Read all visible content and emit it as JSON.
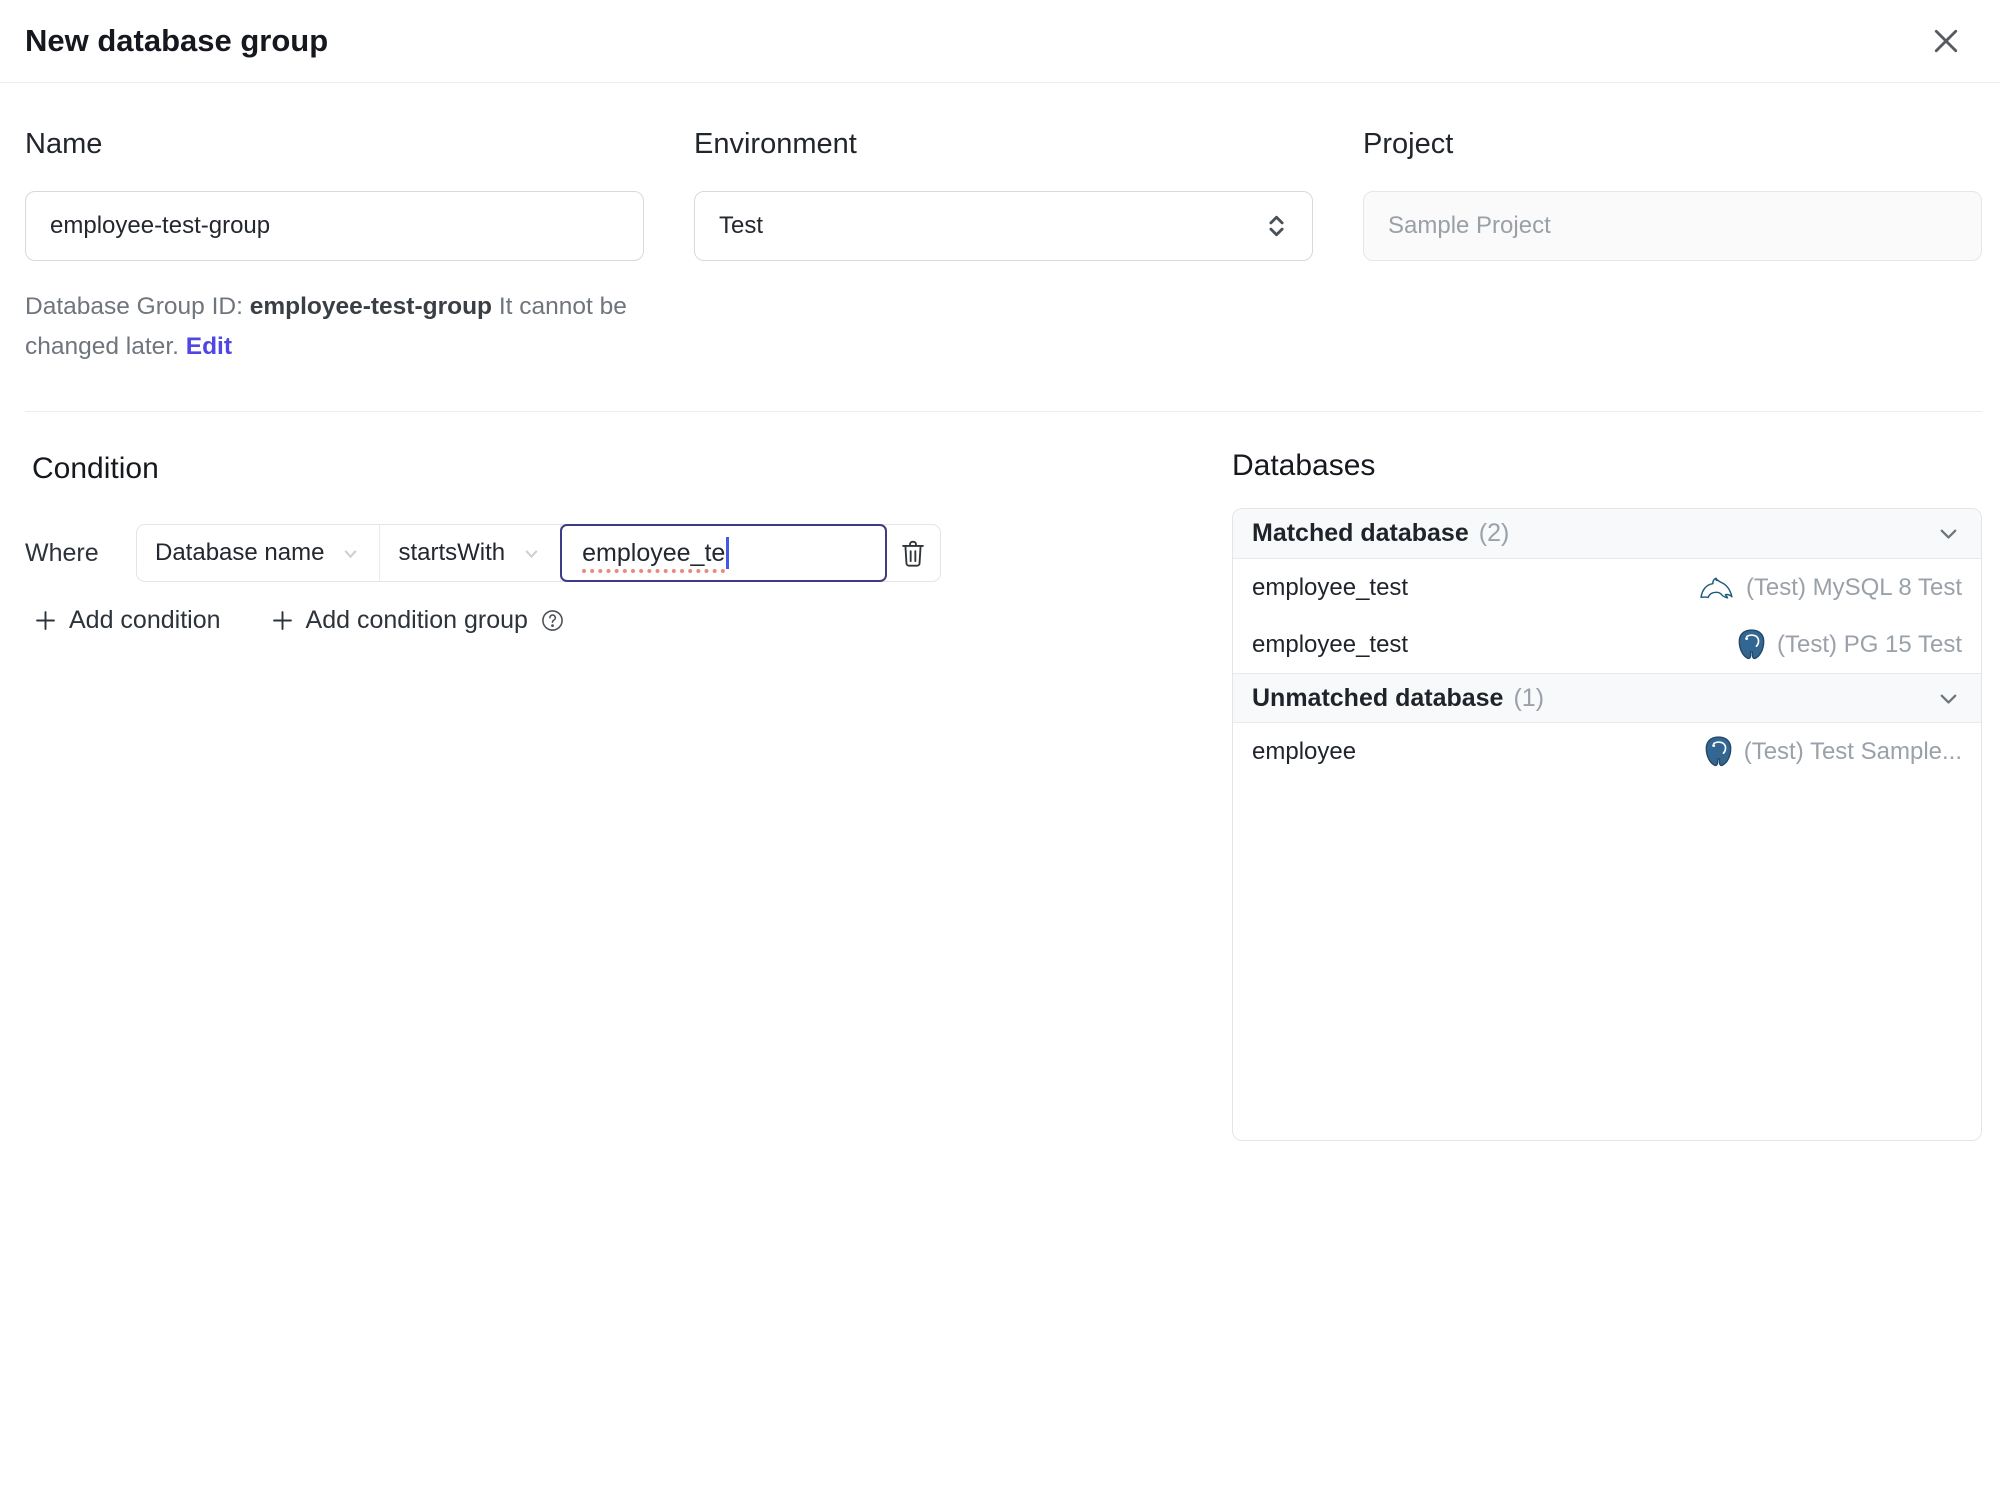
{
  "dialog": {
    "title": "New database group"
  },
  "form": {
    "name": {
      "label": "Name",
      "value": "employee-test-group"
    },
    "environment": {
      "label": "Environment",
      "value": "Test"
    },
    "project": {
      "label": "Project",
      "value": "Sample Project"
    },
    "id_hint": {
      "prefix": "Database Group ID: ",
      "id": "employee-test-group",
      "suffix": " It cannot be changed later. ",
      "edit_label": "Edit"
    }
  },
  "condition": {
    "heading": "Condition",
    "where_label": "Where",
    "factor": "Database name",
    "operator": "startsWith",
    "value": "employee_te",
    "add_condition_label": "Add condition",
    "add_condition_group_label": "Add condition group"
  },
  "databases": {
    "heading": "Databases",
    "matched": {
      "title": "Matched database",
      "count": "(2)",
      "rows": [
        {
          "name": "employee_test",
          "engine": "mysql",
          "instance": "(Test) MySQL 8 Test"
        },
        {
          "name": "employee_test",
          "engine": "postgres",
          "instance": "(Test) PG 15 Test"
        }
      ]
    },
    "unmatched": {
      "title": "Unmatched database",
      "count": "(1)",
      "rows": [
        {
          "name": "employee",
          "engine": "postgres",
          "instance": "(Test) Test Sample..."
        }
      ]
    }
  },
  "icons": {
    "close": "x-cross",
    "environment_select": "chevron-up-down",
    "dropdown": "chevron-down",
    "delete_condition": "trash",
    "add": "plus",
    "help": "question-circle",
    "collapse": "chevron-down",
    "mysql": "mysql-dolphin",
    "postgres": "postgres-elephant"
  },
  "colors": {
    "accent": "#4f46e5",
    "focus_border": "#3e3b86",
    "mysql_icon": "#1e5c77",
    "postgres_icon": "#336791",
    "header_bg": "#f8f9fa",
    "border": "#e3e5e8"
  }
}
